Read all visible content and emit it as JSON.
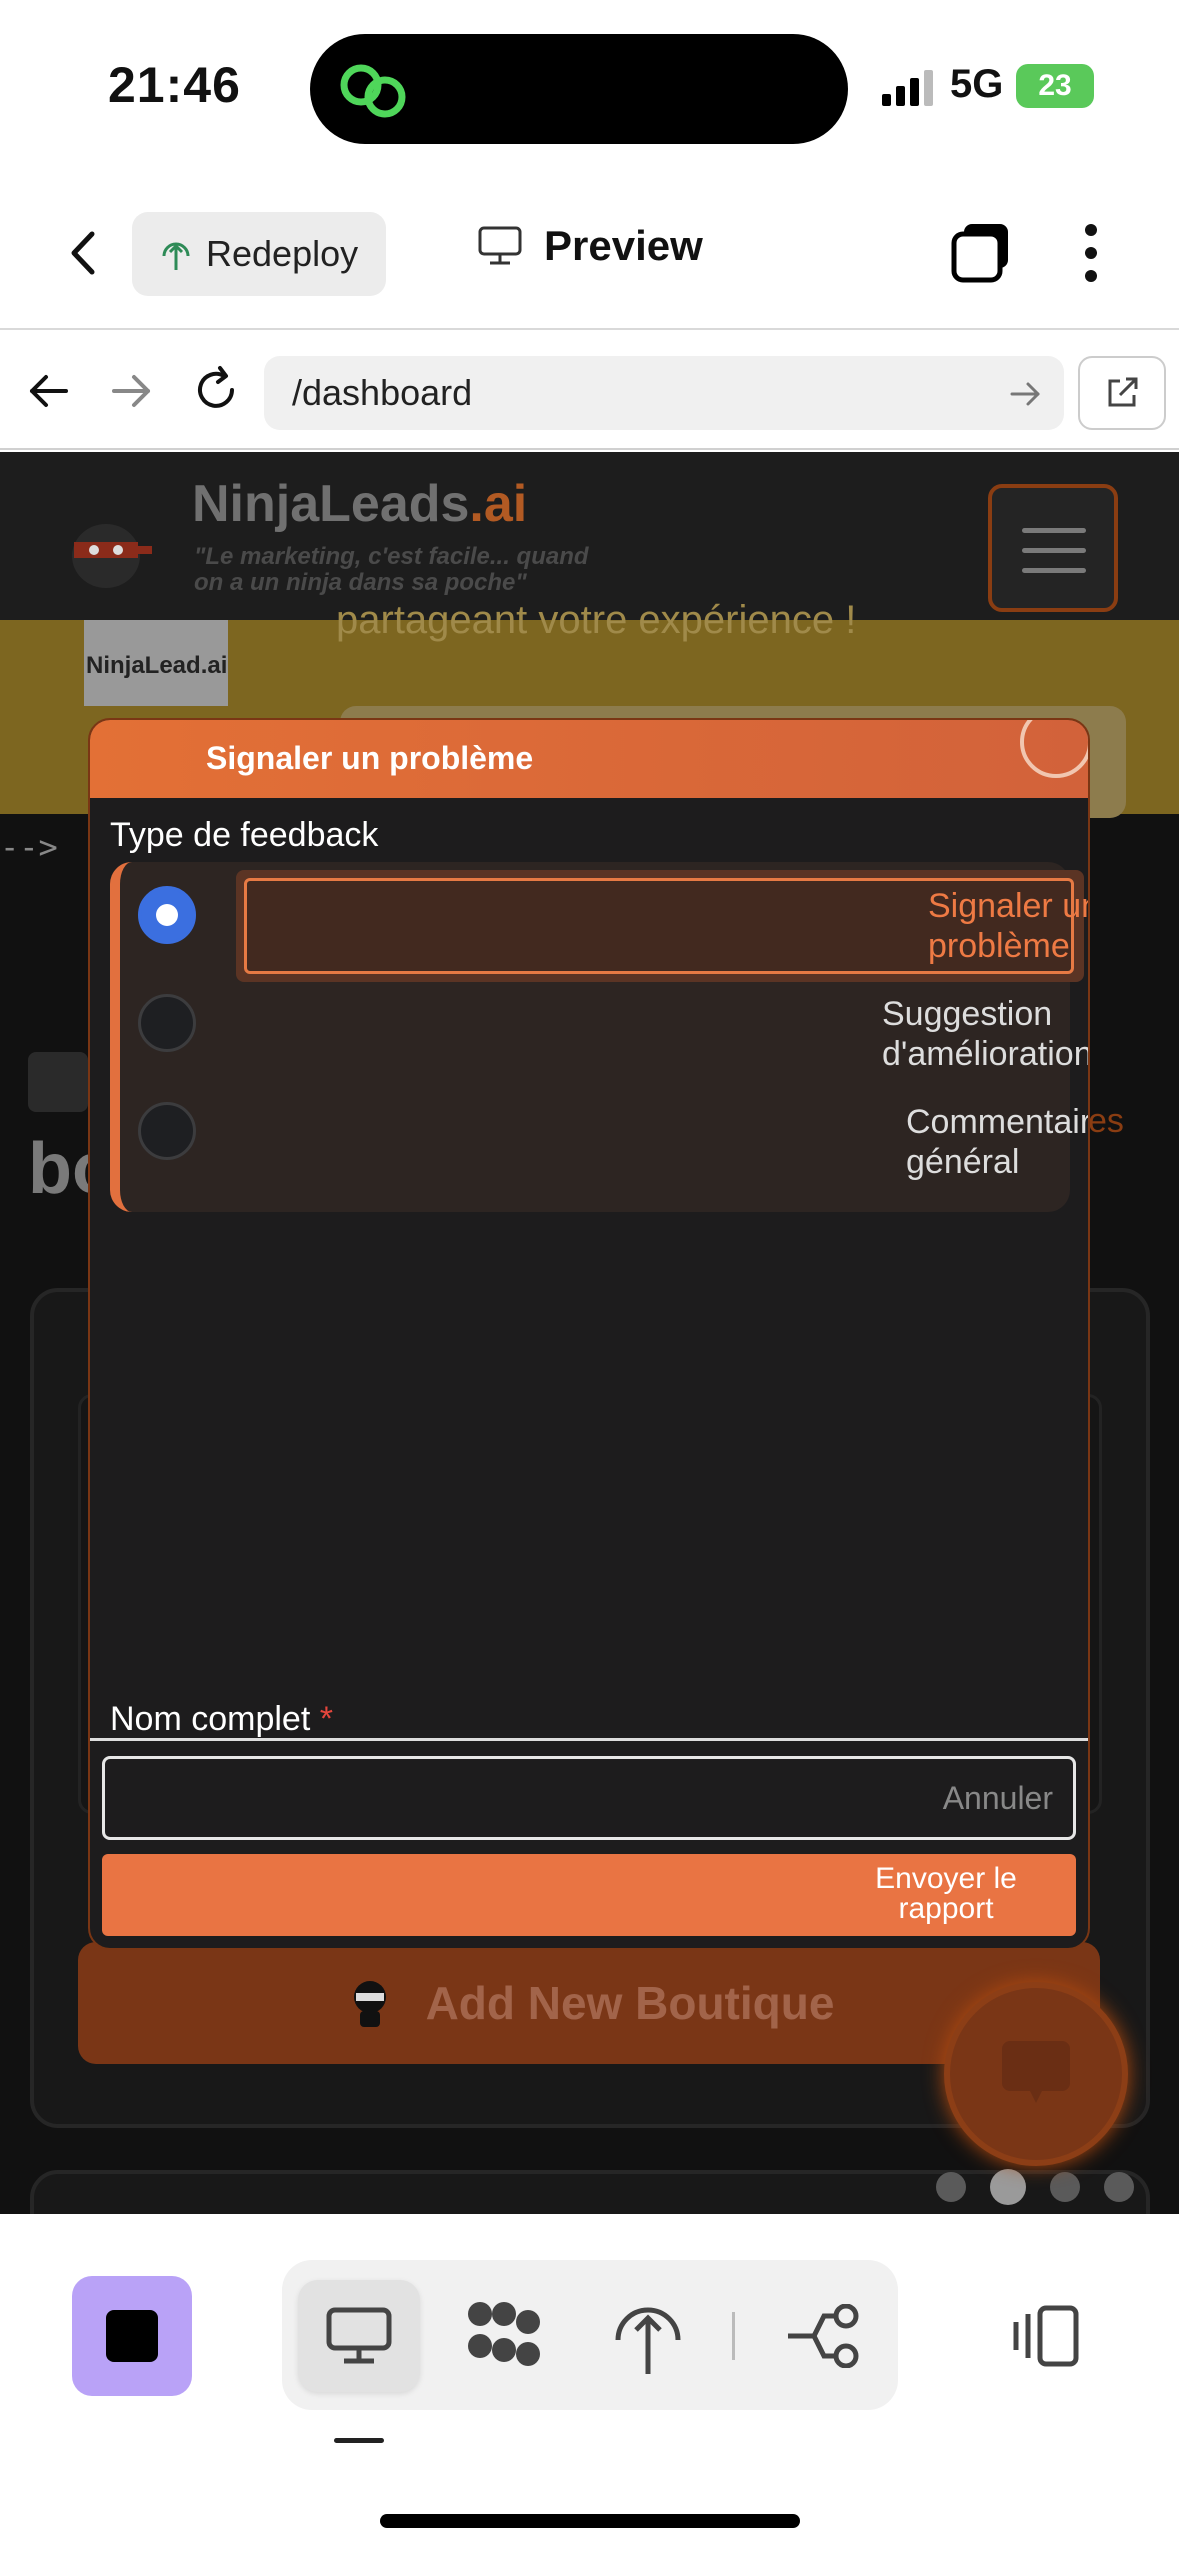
{
  "status_bar": {
    "time": "21:46",
    "network": "5G",
    "battery": "23"
  },
  "app_toolbar": {
    "redeploy_label": "Redeploy",
    "preview_label": "Preview"
  },
  "browser": {
    "url": "/dashboard"
  },
  "site": {
    "name_main": "NinjaLeads",
    "name_suffix": ".ai",
    "tagline": "\"Le marketing, c'est facile... quand on a un ninja dans sa poche\"",
    "banner_logo_text": "NinjaLead.ai",
    "banner_text": "partageant votre expérience !",
    "html_comment": "-->",
    "bg_heading_fragment": "bo",
    "bg_link_fragment": "es",
    "add_boutique_label": "Add New Boutique"
  },
  "modal": {
    "title": "Signaler un problème",
    "feedback_type_label": "Type de feedback",
    "options": [
      {
        "label": "Signaler un problème",
        "selected": true
      },
      {
        "label": "Suggestion d'amélioration",
        "selected": false
      },
      {
        "label": "Commentaire général",
        "selected": false
      }
    ],
    "name_label": "Nom complet",
    "required_marker": "*",
    "cancel_label": "Annuler",
    "submit_label": "Envoyer le rapport"
  },
  "colors": {
    "accent": "#e97443",
    "radio_selected": "#3b6fe0",
    "stop_button": "#b9a2f7"
  },
  "icons": {
    "back": "chevron-left-icon",
    "redeploy": "globe-upload-icon",
    "preview": "monitor-icon",
    "tabs": "tabs-icon",
    "more": "more-vertical-icon",
    "chat": "chat-bubble-icon"
  }
}
